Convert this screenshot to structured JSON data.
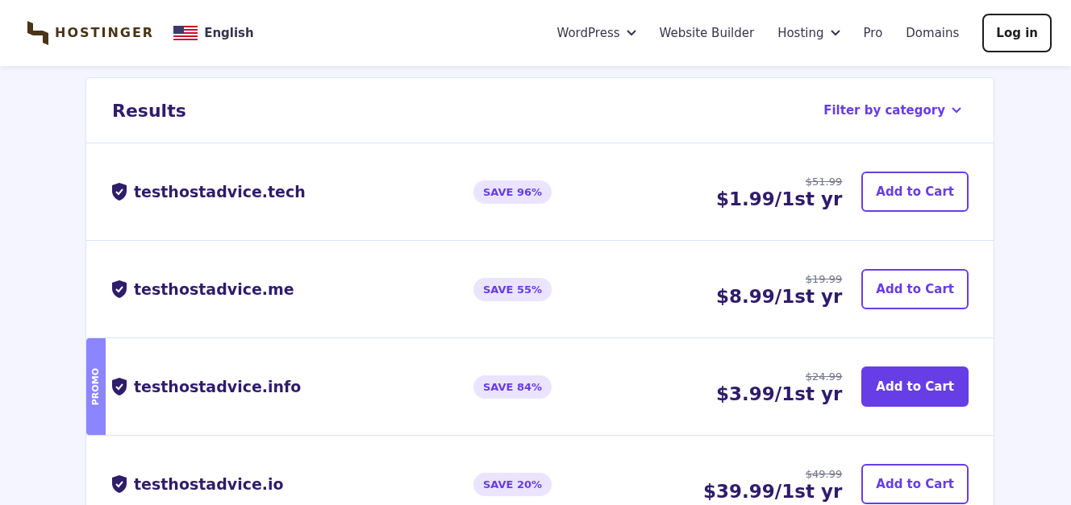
{
  "header": {
    "brand": "HOSTINGER",
    "language": "English",
    "nav": [
      {
        "label": "WordPress",
        "dropdown": true
      },
      {
        "label": "Website Builder",
        "dropdown": false
      },
      {
        "label": "Hosting",
        "dropdown": true
      },
      {
        "label": "Pro",
        "dropdown": false
      },
      {
        "label": "Domains",
        "dropdown": false
      }
    ],
    "login": "Log in"
  },
  "results": {
    "title": "Results",
    "filter": "Filter by category",
    "rows": [
      {
        "domain": "testhostadvice.tech",
        "save": "SAVE 96%",
        "old_price": "$51.99",
        "price": "$1.99/1st yr",
        "button": "Add to Cart",
        "featured": false
      },
      {
        "domain": "testhostadvice.me",
        "save": "SAVE 55%",
        "old_price": "$19.99",
        "price": "$8.99/1st yr",
        "button": "Add to Cart",
        "featured": false
      },
      {
        "domain": "testhostadvice.info",
        "save": "SAVE 84%",
        "old_price": "$24.99",
        "price": "$3.99/1st yr",
        "button": "Add to Cart",
        "featured": true,
        "tag": "PROMO"
      },
      {
        "domain": "testhostadvice.io",
        "save": "SAVE 20%",
        "old_price": "$49.99",
        "price": "$39.99/1st yr",
        "button": "Add to Cart",
        "featured": false
      }
    ]
  }
}
